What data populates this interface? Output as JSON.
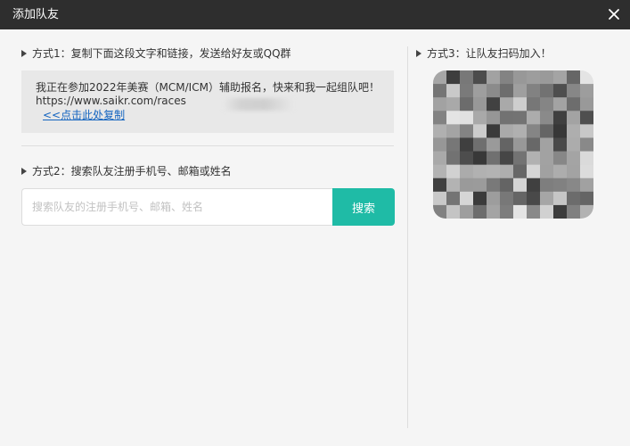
{
  "window": {
    "title": "添加队友",
    "close_icon": "close-icon"
  },
  "method1": {
    "heading": "方式1：复制下面这段文字和链接，发送给好友或QQ群",
    "share_text": "我正在参加2022年美赛（MCM/ICM）辅助报名，快来和我一起组队吧！https://www.saikr.com/races",
    "copy_link_label": "<<点击此处复制"
  },
  "method2": {
    "heading": "方式2：搜索队友注册手机号、邮箱或姓名",
    "search_placeholder": "搜索队友的注册手机号、邮箱、姓名",
    "search_value": "",
    "search_button_label": "搜索"
  },
  "method3": {
    "heading": "方式3：让队友扫码加入！",
    "qr_icon": "qr-code-icon"
  },
  "colors": {
    "titlebar": "#2e2e2e",
    "accent": "#1fbba6",
    "link": "#1565c0",
    "background": "#f5f5f5"
  }
}
